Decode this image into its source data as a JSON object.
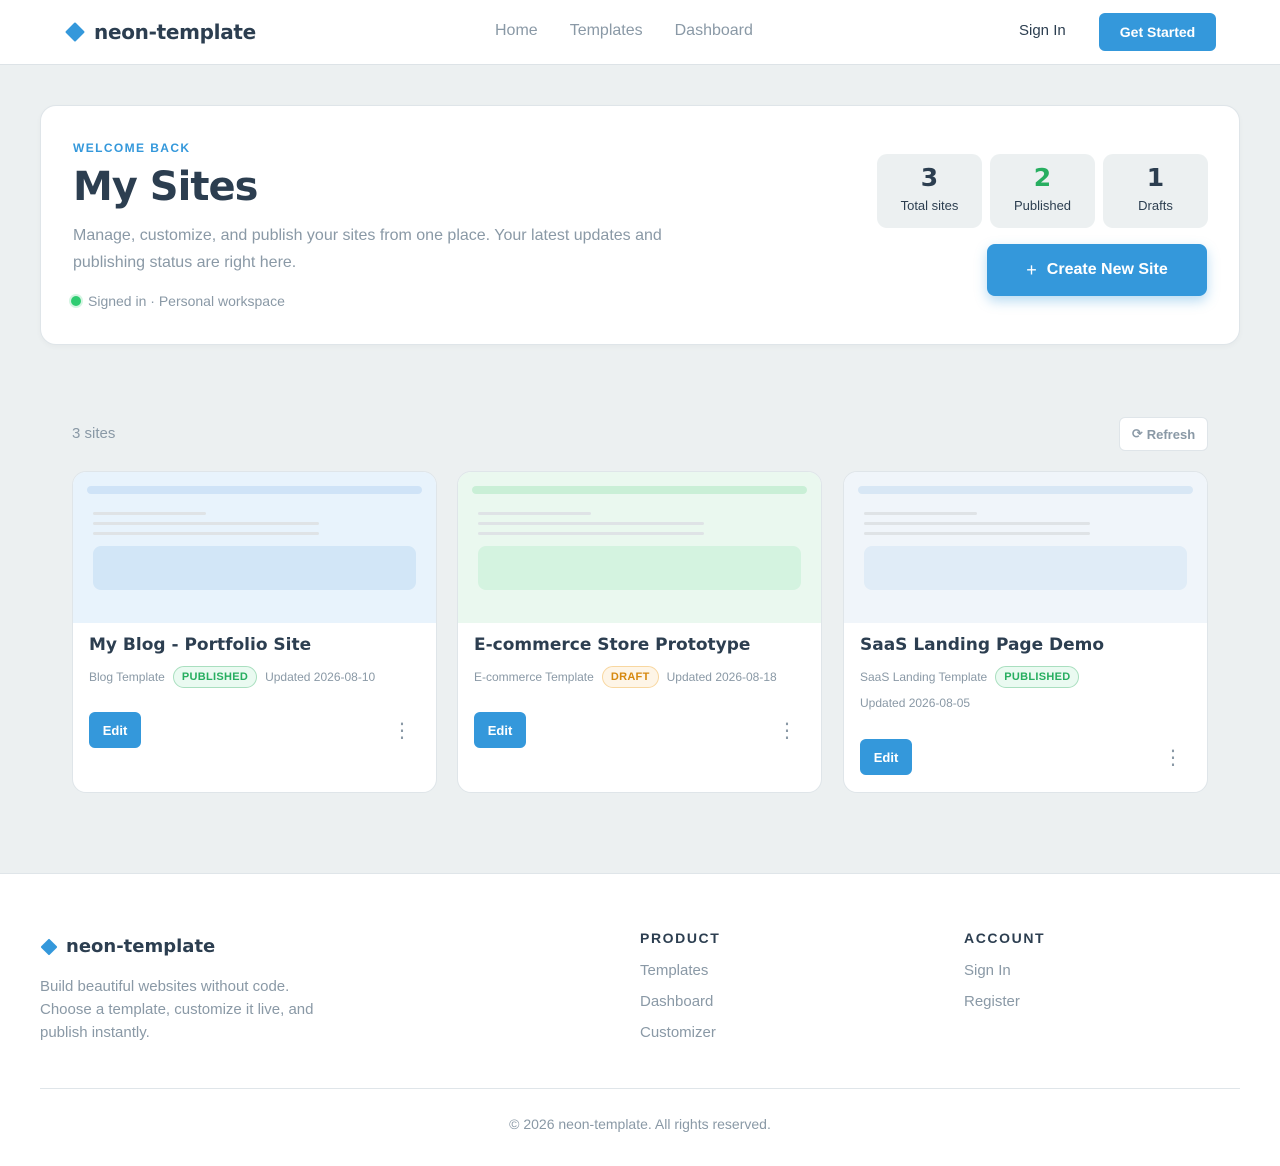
{
  "brand": {
    "name": "neon-template"
  },
  "nav": {
    "items": [
      "Home",
      "Templates",
      "Dashboard"
    ]
  },
  "header": {
    "sign_in": "Sign In",
    "get_started": "Get Started"
  },
  "hero": {
    "eyebrow": "WELCOME BACK",
    "title": "My Sites",
    "description": "Manage, customize, and publish your sites from one place. Your latest updates and publishing status are right here.",
    "status": "Signed in · Personal workspace",
    "stats": [
      {
        "value": "3",
        "label": "Total sites"
      },
      {
        "value": "2",
        "label": "Published"
      },
      {
        "value": "1",
        "label": "Drafts"
      }
    ],
    "create_plus": "+",
    "create_label": "Create New Site"
  },
  "list": {
    "count": "3 sites",
    "refresh_icon": "⟳",
    "refresh_label": "Refresh"
  },
  "sites": [
    {
      "title": "My Blog - Portfolio Site",
      "template": "Blog Template",
      "status": "PUBLISHED",
      "updated": "Updated 2026-08-10",
      "edit": "Edit",
      "menu": "⋮"
    },
    {
      "title": "E-commerce Store Prototype",
      "template": "E-commerce Template",
      "status": "DRAFT",
      "updated": "Updated 2026-08-18",
      "edit": "Edit",
      "menu": "⋮"
    },
    {
      "title": "SaaS Landing Page Demo",
      "template": "SaaS Landing Template",
      "status": "PUBLISHED",
      "updated": "Updated 2026-08-05",
      "edit": "Edit",
      "menu": "⋮"
    }
  ],
  "footer": {
    "brand": "neon-template",
    "description": "Build beautiful websites without code. Choose a template, customize it live, and publish instantly.",
    "product": {
      "heading": "PRODUCT",
      "links": [
        "Templates",
        "Dashboard",
        "Customizer"
      ]
    },
    "account": {
      "heading": "ACCOUNT",
      "links": [
        "Sign In",
        "Register"
      ]
    },
    "copyright": "© 2026 neon-template. All rights reserved."
  },
  "colors": {
    "accent": "#3498db",
    "text": "#2c3e50",
    "muted": "#8a99a6",
    "page_bg": "#ecf0f1",
    "published": "#27ae60",
    "draft": "#d68910",
    "online": "#2ecc71"
  }
}
